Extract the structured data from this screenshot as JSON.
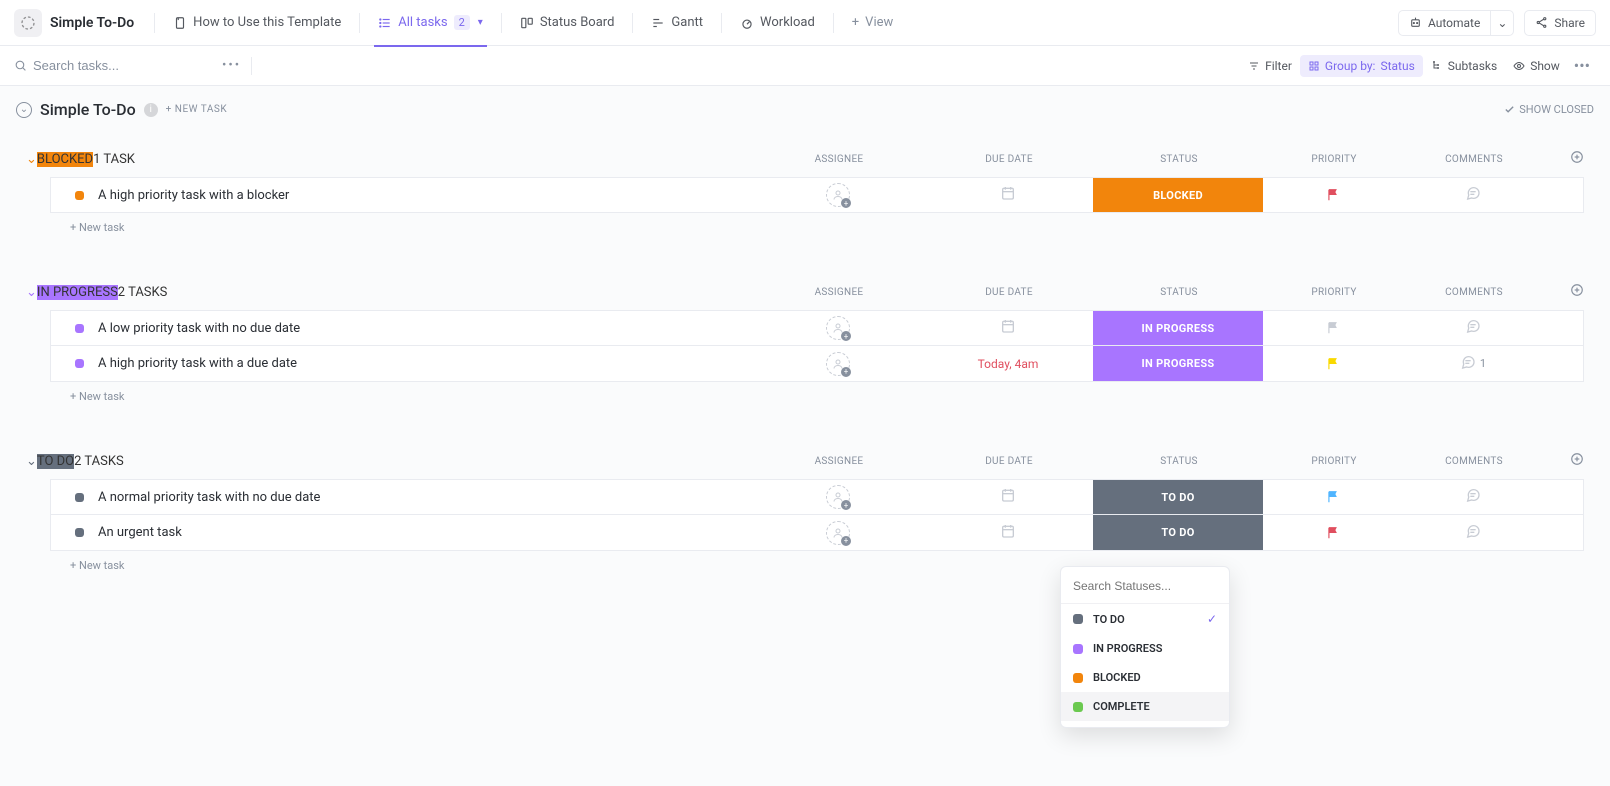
{
  "colors": {
    "blocked": "#f2850c",
    "in_progress": "#a875ff",
    "todo": "#656f7d",
    "complete": "#6bc950",
    "accent": "#7b68ee",
    "flag_red": "#e04f5f",
    "flag_yellow": "#f9d900",
    "flag_gray": "#c8ccd4",
    "flag_blue": "#50b5ff"
  },
  "topbar": {
    "list_name": "Simple To-Do",
    "template_tab": "How to Use this Template",
    "views": {
      "all_tasks": "All tasks",
      "all_tasks_count": "2",
      "status_board": "Status Board",
      "gantt": "Gantt",
      "workload": "Workload"
    },
    "add_view": "View",
    "automate": "Automate",
    "share": "Share"
  },
  "filterbar": {
    "search_placeholder": "Search tasks...",
    "filter": "Filter",
    "group_by_label": "Group by:",
    "group_by_value": "Status",
    "subtasks": "Subtasks",
    "show": "Show"
  },
  "list_header": {
    "title": "Simple To-Do",
    "new_task": "+ NEW TASK",
    "show_closed": "SHOW CLOSED"
  },
  "columns": {
    "assignee": "ASSIGNEE",
    "due_date": "DUE DATE",
    "status": "STATUS",
    "priority": "PRIORITY",
    "comments": "COMMENTS"
  },
  "new_task_text": "+ New task",
  "groups": [
    {
      "key": "blocked",
      "label": "BLOCKED",
      "color": "#f2850c",
      "count_text": "1 TASK",
      "tasks": [
        {
          "title": "A high priority task with a blocker",
          "status_label": "BLOCKED",
          "status_color": "#f2850c",
          "flag_color": "#e04f5f",
          "due": "",
          "comments": ""
        }
      ]
    },
    {
      "key": "in_progress",
      "label": "IN PROGRESS",
      "color": "#a875ff",
      "count_text": "2 TASKS",
      "tasks": [
        {
          "title": "A low priority task with no due date",
          "status_label": "IN PROGRESS",
          "status_color": "#a875ff",
          "flag_color": "#c8ccd4",
          "due": "",
          "comments": ""
        },
        {
          "title": "A high priority task with a due date",
          "status_label": "IN PROGRESS",
          "status_color": "#a875ff",
          "flag_color": "#f9d900",
          "due": "Today, 4am",
          "comments": "1"
        }
      ]
    },
    {
      "key": "todo",
      "label": "TO DO",
      "color": "#656f7d",
      "count_text": "2 TASKS",
      "tasks": [
        {
          "title": "A normal priority task with no due date",
          "status_label": "TO DO",
          "status_color": "#656f7d",
          "flag_color": "#50b5ff",
          "due": "",
          "comments": ""
        },
        {
          "title": "An urgent task",
          "status_label": "TO DO",
          "status_color": "#656f7d",
          "flag_color": "#e04f5f",
          "due": "",
          "comments": ""
        }
      ]
    }
  ],
  "status_dropdown": {
    "placeholder": "Search Statuses...",
    "options": [
      {
        "label": "TO DO",
        "color": "#656f7d",
        "selected": true
      },
      {
        "label": "IN PROGRESS",
        "color": "#a875ff",
        "selected": false
      },
      {
        "label": "BLOCKED",
        "color": "#f2850c",
        "selected": false
      },
      {
        "label": "COMPLETE",
        "color": "#6bc950",
        "selected": false,
        "highlight": true
      }
    ]
  }
}
